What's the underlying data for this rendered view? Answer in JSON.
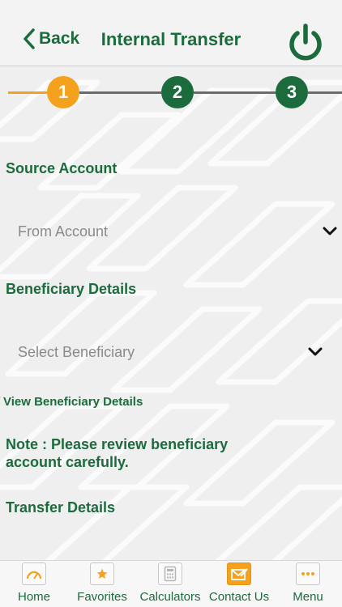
{
  "header": {
    "back_label": "Back",
    "title": "Internal Transfer"
  },
  "stepper": {
    "steps": [
      "1",
      "2",
      "3"
    ],
    "active_step": 1
  },
  "source": {
    "title": "Source Account",
    "placeholder": "From Account"
  },
  "beneficiary": {
    "title": "Beneficiary Details",
    "placeholder": "Select Beneficiary",
    "view_link": "View Beneficiary Details"
  },
  "note": "Note : Please review beneficiary account carefully.",
  "transfer": {
    "title": "Transfer Details"
  },
  "tabs": [
    {
      "label": "Home",
      "icon": "speedometer-icon"
    },
    {
      "label": "Favorites",
      "icon": "star-icon"
    },
    {
      "label": "Calculators",
      "icon": "calculator-icon"
    },
    {
      "label": "Contact Us",
      "icon": "mail-edit-icon"
    },
    {
      "label": "Menu",
      "icon": "more-dots-icon"
    }
  ],
  "colors": {
    "brand_green": "#1b6b3d",
    "accent_orange": "#f4a21e",
    "placeholder_gray": "#8a8a8a"
  }
}
